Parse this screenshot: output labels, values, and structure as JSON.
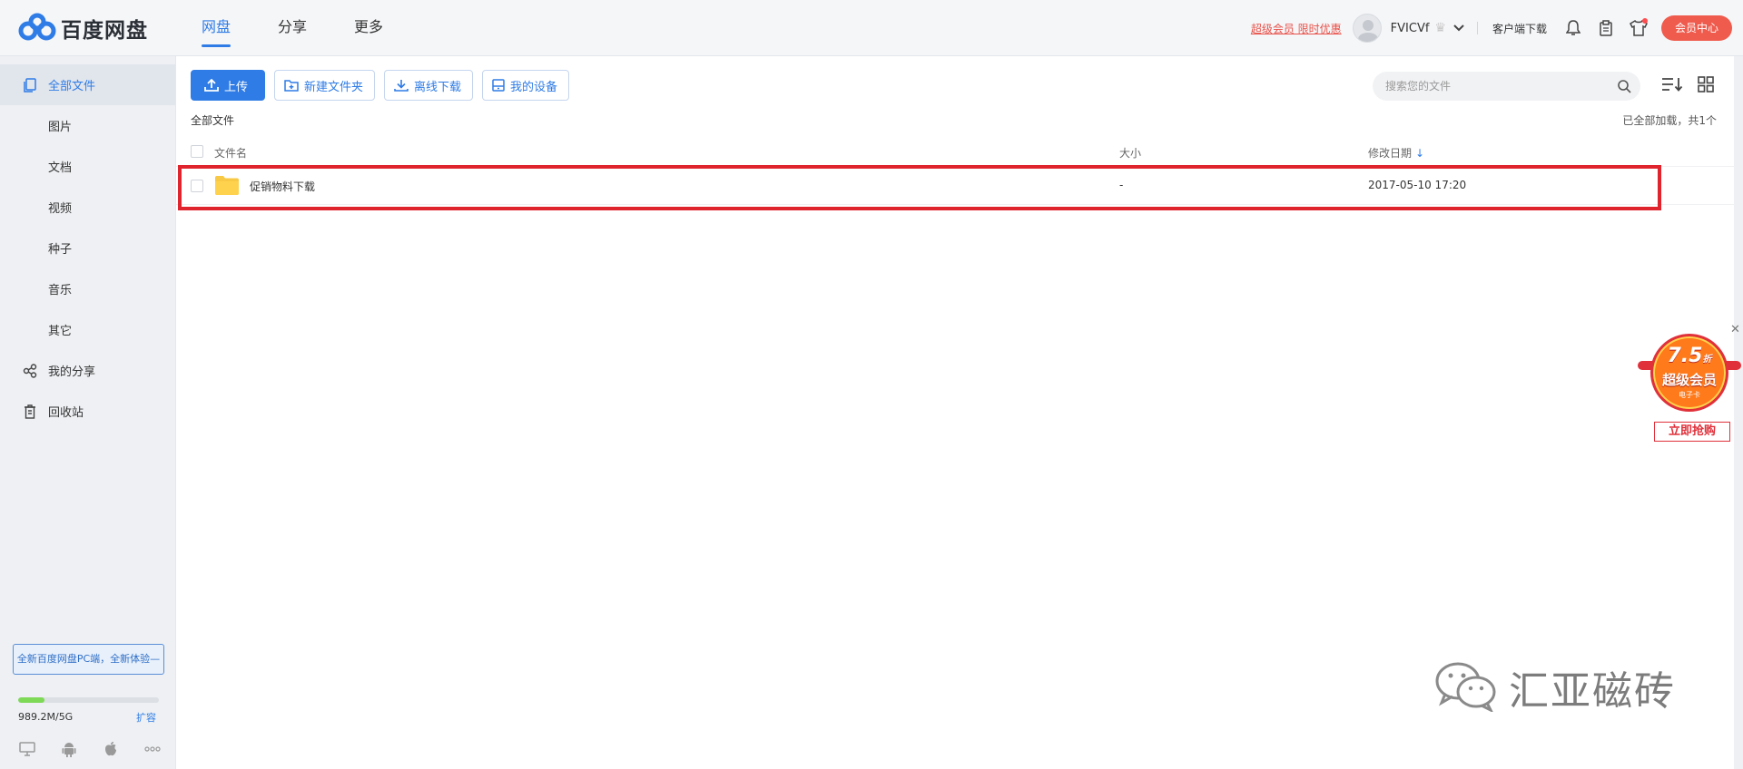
{
  "brand": {
    "name": "百度网盘"
  },
  "nav": {
    "tabs": [
      {
        "label": "网盘"
      },
      {
        "label": "分享"
      },
      {
        "label": "更多"
      }
    ]
  },
  "header": {
    "promo_link": "超级会员 限时优惠",
    "username": "FVICVf",
    "client_download": "客户端下载",
    "vip_center": "会员中心"
  },
  "sidebar": {
    "items": [
      {
        "label": "全部文件",
        "icon": "file-icon",
        "active": true
      },
      {
        "label": "图片"
      },
      {
        "label": "文档"
      },
      {
        "label": "视频"
      },
      {
        "label": "种子"
      },
      {
        "label": "音乐"
      },
      {
        "label": "其它"
      },
      {
        "label": "我的分享",
        "icon": "share-icon"
      },
      {
        "label": "回收站",
        "icon": "trash-icon"
      }
    ],
    "promo_banner": "全新百度网盘PC端，全新体验—",
    "quota": {
      "used_fraction": 0.19,
      "text": "989.2M/5G",
      "expand_label": "扩容"
    },
    "devices": [
      "desktop-icon",
      "android-icon",
      "apple-icon",
      "more-icon"
    ]
  },
  "toolbar": {
    "upload": "上传",
    "new_folder": "新建文件夹",
    "offline_download": "离线下载",
    "my_devices": "我的设备"
  },
  "search": {
    "placeholder": "搜索您的文件"
  },
  "breadcrumb": "全部文件",
  "loaded_status": "已全部加载，共1个",
  "table": {
    "headers": {
      "name": "文件名",
      "size": "大小",
      "date": "修改日期"
    },
    "rows": [
      {
        "name": "促销物料下载",
        "size": "-",
        "date": "2017-05-10 17:20",
        "type": "folder"
      }
    ]
  },
  "ad": {
    "discount": "7.5",
    "discount_suffix": "折",
    "title": "超级会员",
    "subtitle": "电子卡",
    "buy": "立即抢购"
  },
  "watermark": {
    "text": "汇亚磁砖"
  },
  "colors": {
    "accent": "#2f7ce6",
    "highlight": "#e0242e",
    "vip": "#ef5b4d",
    "folder": "#ffd24d"
  }
}
